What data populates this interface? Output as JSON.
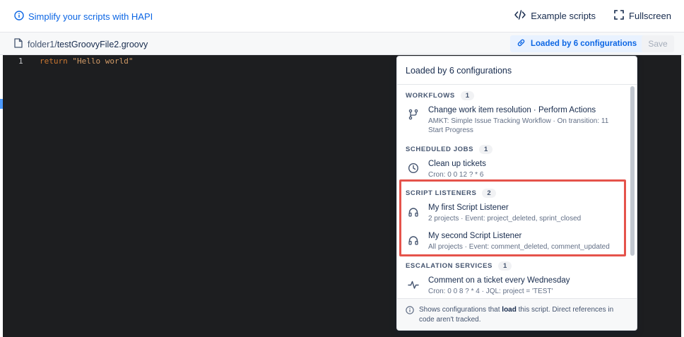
{
  "topbar": {
    "hapi_link": "Simplify your scripts with HAPI",
    "example_scripts": "Example scripts",
    "fullscreen": "Fullscreen"
  },
  "filebar": {
    "folder": "folder1/",
    "filename": "testGroovyFile2.groovy",
    "loaded_label": "Loaded by 6 configurations",
    "save_label": "Save"
  },
  "editor": {
    "line_number": "1",
    "keyword": "return",
    "string": "\"Hello world\""
  },
  "dropdown": {
    "header": "Loaded by 6 configurations",
    "sections": [
      {
        "title": "WORKFLOWS",
        "count": "1",
        "items": [
          {
            "title": "Change work item resolution · Perform Actions",
            "subtitle_1": "AMKT: Simple Issue Tracking Workflow · On transition: 11",
            "subtitle_2": "Start Progress",
            "icon": "workflow-icon"
          }
        ]
      },
      {
        "title": "SCHEDULED JOBS",
        "count": "1",
        "items": [
          {
            "title": "Clean up tickets",
            "subtitle_1": "Cron: 0 0 12 ? * 6",
            "icon": "clock-icon"
          }
        ]
      },
      {
        "title": "SCRIPT LISTENERS",
        "count": "2",
        "items": [
          {
            "title": "My first Script Listener",
            "subtitle_1": "2 projects · Event: project_deleted, sprint_closed",
            "icon": "headphones-icon"
          },
          {
            "title": "My second Script Listener",
            "subtitle_1": "All projects · Event: comment_deleted, comment_updated",
            "icon": "headphones-icon"
          }
        ]
      },
      {
        "title": "ESCALATION SERVICES",
        "count": "1",
        "items": [
          {
            "title": "Comment on a ticket every Wednesday",
            "subtitle_1": "Cron: 0 0 8 ? * 4 · JQL: project = 'TEST'",
            "icon": "pulse-icon"
          }
        ]
      }
    ],
    "footer_pre": "Shows configurations that ",
    "footer_bold": "load",
    "footer_post": " this script. Direct references in code aren't tracked."
  },
  "colors": {
    "accent": "#0c66e4",
    "highlight": "#e5534b",
    "editor_bg": "#1d1e20"
  }
}
